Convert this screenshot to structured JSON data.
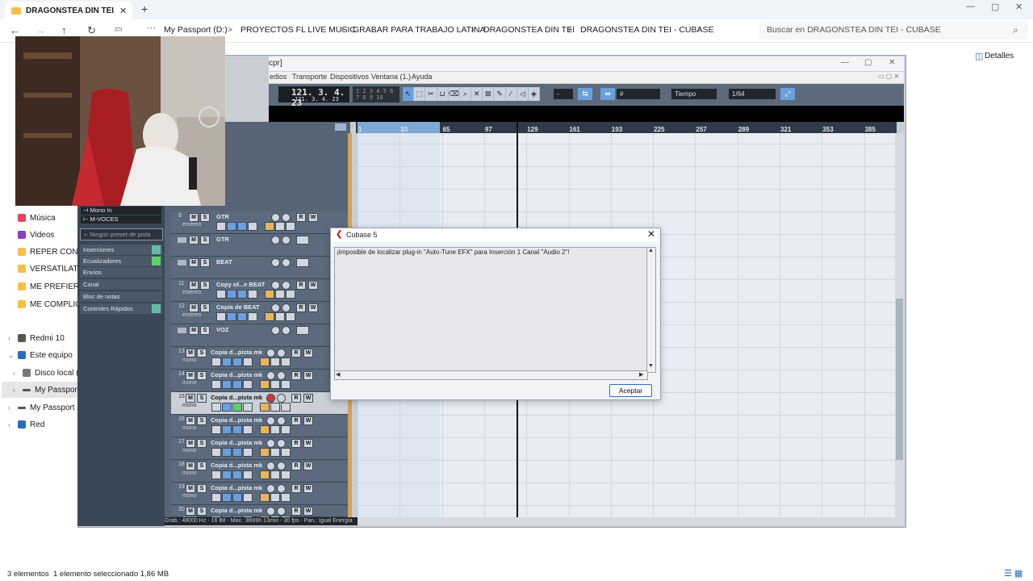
{
  "explorer": {
    "tab_title": "DRAGONSTEA DIN TEI - CUBASE",
    "tab_close": "✕",
    "new_tab": "+",
    "window_controls": {
      "minimize": "—",
      "maximize": "▢",
      "close": "✕"
    },
    "nav": {
      "back": "←",
      "forward": "→",
      "up": "↑",
      "refresh": "↻",
      "more": "···"
    },
    "breadcrumbs": [
      "My Passport (D:)",
      "PROYECTOS FL LIVE MUSIC",
      "GRABAR PARA TRABAJO LATINA",
      "DRAGONSTEA DIN TEI",
      "DRAGONSTEA DIN TEI - CUBASE"
    ],
    "breadcrumb_separator": ">",
    "search_placeholder": "Buscar en DRAGONSTEA DIN TEI - CUBASE",
    "details_label": "Detalles",
    "sidebar": [
      {
        "label": "Música",
        "icon": "music-icon",
        "color": "#e2475b"
      },
      {
        "label": "Videos",
        "icon": "video-icon",
        "color": "#8a3fc4"
      },
      {
        "label": "REPER CONCURSO",
        "icon": "folder-icon",
        "color": "#f4c04a"
      },
      {
        "label": "VERSATILATHIOPIC",
        "icon": "folder-icon",
        "color": "#f4c04a"
      },
      {
        "label": "ME PREFIERES A MI",
        "icon": "folder-icon",
        "color": "#f4c04a"
      },
      {
        "label": "ME COMPLICO SI",
        "icon": "folder-icon",
        "color": "#f4c04a"
      },
      {
        "label": "Redmi 10",
        "icon": "phone-icon",
        "color": "#555555"
      },
      {
        "label": "Este equipo",
        "icon": "computer-icon",
        "color": "#2a6dc0"
      },
      {
        "label": "Disco local (C:)",
        "icon": "drive-icon",
        "color": "#777777"
      },
      {
        "label": "My Passport (D:)",
        "icon": "drive-icon",
        "color": "#555555"
      },
      {
        "label": "My Passport (D:)",
        "icon": "drive-icon",
        "color": "#555555"
      },
      {
        "label": "Red",
        "icon": "network-icon",
        "color": "#2a6dc0"
      }
    ],
    "status": {
      "count": "3 elementos",
      "selection": "1 elemento seleccionado  1,86 MB"
    }
  },
  "cubase": {
    "title_fragment": "cpr]",
    "menu": [
      "edios",
      "Transporte",
      "Dispositivos",
      "Ventana (1.)",
      "Ayuda"
    ],
    "lcd_big": "121. 3. 4. 23",
    "lcd_small": "121. 3. 4. 23",
    "lcd_grid": "1 2 3 4 5 6 7 8 9 10",
    "quantize_label": "Tiempo",
    "quantize_value": "1/64",
    "ruler_ticks": [
      "1",
      "33",
      "65",
      "97",
      "129",
      "161",
      "193",
      "225",
      "257",
      "289",
      "321",
      "353",
      "385"
    ],
    "inspector": {
      "input": "Mono In",
      "output": "M-VOCES",
      "preset_placeholder": "Ningún preset de pista",
      "sections": [
        "Inserciones",
        "Ecualizadores",
        "Envíos",
        "Canal",
        "Bloc de notas",
        "Controles Rápidos"
      ]
    },
    "tracks": [
      {
        "num": "9",
        "name": "GTR",
        "sub": "estéreo"
      },
      {
        "num": "",
        "name": "GTR",
        "sub": ""
      },
      {
        "num": "",
        "name": "BEAT",
        "sub": ""
      },
      {
        "num": "11",
        "name": "Copy of...e BEAT",
        "sub": "estéreo"
      },
      {
        "num": "12",
        "name": "Copia de BEAT",
        "sub": "estéreo"
      },
      {
        "num": "",
        "name": "VOZ",
        "sub": ""
      },
      {
        "num": "13",
        "name": "Copia d...pista mk",
        "sub": "mono"
      },
      {
        "num": "14",
        "name": "Copia d...pista mk",
        "sub": "mono"
      },
      {
        "num": "15",
        "name": "Copia d...pista mk",
        "sub": "mono"
      },
      {
        "num": "16",
        "name": "Copia d...pista mk",
        "sub": "mono"
      },
      {
        "num": "17",
        "name": "Copia d...pista mk",
        "sub": "mono"
      },
      {
        "num": "18",
        "name": "Copia d...pista mk",
        "sub": "mono"
      },
      {
        "num": "19",
        "name": "Copia d...pista mk",
        "sub": "mono"
      },
      {
        "num": "20",
        "name": "Copia d...pista mk",
        "sub": "mono"
      }
    ],
    "status_bar": "Grab.: 48000 Hz - 16 Bit - Max.: 8699h 13min - 30 fps - Pan.: Igual Energía"
  },
  "dialog": {
    "title": "Cubase 5",
    "message": "¡Imposible de localizar plug-in \"Auto-Tune EFX\" para Inserción 1 Canal \"Audio 2\"!",
    "ok_label": "Aceptar",
    "close": "✕"
  }
}
